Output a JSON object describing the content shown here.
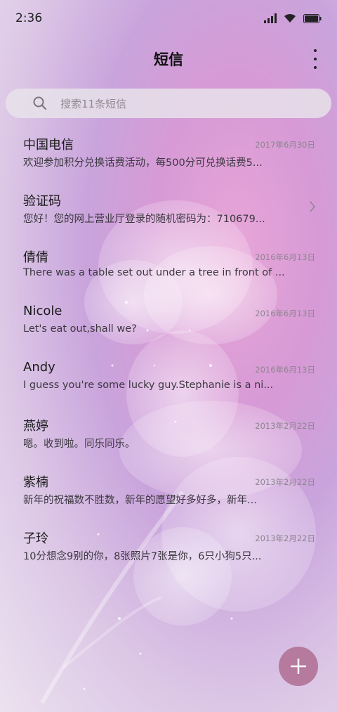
{
  "status_bar": {
    "time": "2:36"
  },
  "title_bar": {
    "title": "短信"
  },
  "search": {
    "placeholder": "搜索11条短信"
  },
  "conversations": [
    {
      "name": "中国电信",
      "date": "2017年6月30日",
      "preview": "欢迎参加积分兑换话费活动，每500分可兑换话费5..."
    },
    {
      "name": "验证码",
      "date": "",
      "preview": "您好！您的网上营业厅登录的随机密码为：710679..."
    },
    {
      "name": "倩倩",
      "date": "2016年6月13日",
      "preview": "There was a table set out under a tree in front of ..."
    },
    {
      "name": "Nicole",
      "date": "2016年6月13日",
      "preview": "Let's eat out,shall we?"
    },
    {
      "name": "Andy",
      "date": "2016年6月13日",
      "preview": "I guess you're some lucky guy.Stephanie is a ni..."
    },
    {
      "name": "燕婷",
      "date": "2013年2月22日",
      "preview": "嗯。收到啦。同乐同乐。"
    },
    {
      "name": "紫楠",
      "date": "2013年2月22日",
      "preview": "新年的祝福数不胜数，新年的愿望好多好多，新年..."
    },
    {
      "name": "子玲",
      "date": "2013年2月22日",
      "preview": "10分想念9别的你，8张照片7张是你，6只小狗5只..."
    }
  ],
  "icons": {
    "status": [
      "signal-icon",
      "wifi-icon",
      "battery-icon"
    ],
    "menu": "more-vertical-icon",
    "search": "search-icon",
    "chevron": "chevron-right-icon",
    "fab": "plus-icon"
  },
  "colors": {
    "fab": "#b57a9e",
    "accent_bg": "#d79ad6"
  }
}
